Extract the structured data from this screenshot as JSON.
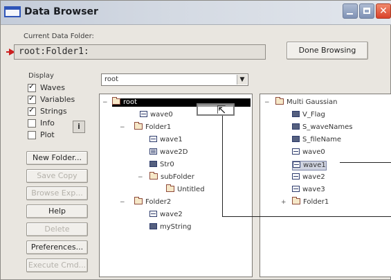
{
  "window": {
    "title": "Data Browser",
    "controls": [
      "minimize-icon",
      "maximize-icon",
      "close-icon"
    ]
  },
  "current_folder": {
    "label": "Current Data Folder:",
    "value": "root:Folder1:"
  },
  "done_button": "Done Browsing",
  "display": {
    "label": "Display",
    "options": [
      {
        "label": "Waves",
        "checked": true
      },
      {
        "label": "Variables",
        "checked": true
      },
      {
        "label": "Strings",
        "checked": true
      },
      {
        "label": "Info",
        "checked": false
      },
      {
        "label": "Plot",
        "checked": false
      }
    ],
    "info_button": "i"
  },
  "left_buttons": [
    {
      "label": "New Folder...",
      "enabled": true
    },
    {
      "label": "Save Copy",
      "enabled": false
    },
    {
      "label": "Browse Exp...",
      "enabled": false
    },
    {
      "label": "Help",
      "enabled": true
    },
    {
      "label": "Delete",
      "enabled": false
    },
    {
      "label": "Preferences...",
      "enabled": true
    },
    {
      "label": "Execute Cmd...",
      "enabled": false
    }
  ],
  "folder_dropdown": {
    "value": "root"
  },
  "left_tree": [
    {
      "label": "root",
      "icon": "folder-icon",
      "selected": true
    },
    {
      "label": "wave0",
      "icon": "wave-icon"
    },
    {
      "label": "Folder1",
      "icon": "folder-icon",
      "current": true
    },
    {
      "label": "wave1",
      "icon": "wave-icon"
    },
    {
      "label": "wave2D",
      "icon": "wave2d-icon"
    },
    {
      "label": "Str0",
      "icon": "string-icon"
    },
    {
      "label": "subFolder",
      "icon": "folder-icon"
    },
    {
      "label": "Untitled",
      "icon": "folder-icon"
    },
    {
      "label": "Folder2",
      "icon": "folder-icon"
    },
    {
      "label": "wave2",
      "icon": "wave-icon"
    },
    {
      "label": "myString",
      "icon": "string-icon"
    }
  ],
  "right_tree": [
    {
      "label": "Multi Gaussian",
      "icon": "folder-icon"
    },
    {
      "label": "V_Flag",
      "icon": "variable-icon"
    },
    {
      "label": "S_waveNames",
      "icon": "string-icon"
    },
    {
      "label": "S_fileName",
      "icon": "string-icon"
    },
    {
      "label": "wave0",
      "icon": "wave-icon"
    },
    {
      "label": "wave1",
      "icon": "wave-icon",
      "highlighted": true
    },
    {
      "label": "wave2",
      "icon": "wave-icon"
    },
    {
      "label": "wave3",
      "icon": "wave-icon"
    },
    {
      "label": "Folder1",
      "icon": "folder-icon"
    }
  ]
}
